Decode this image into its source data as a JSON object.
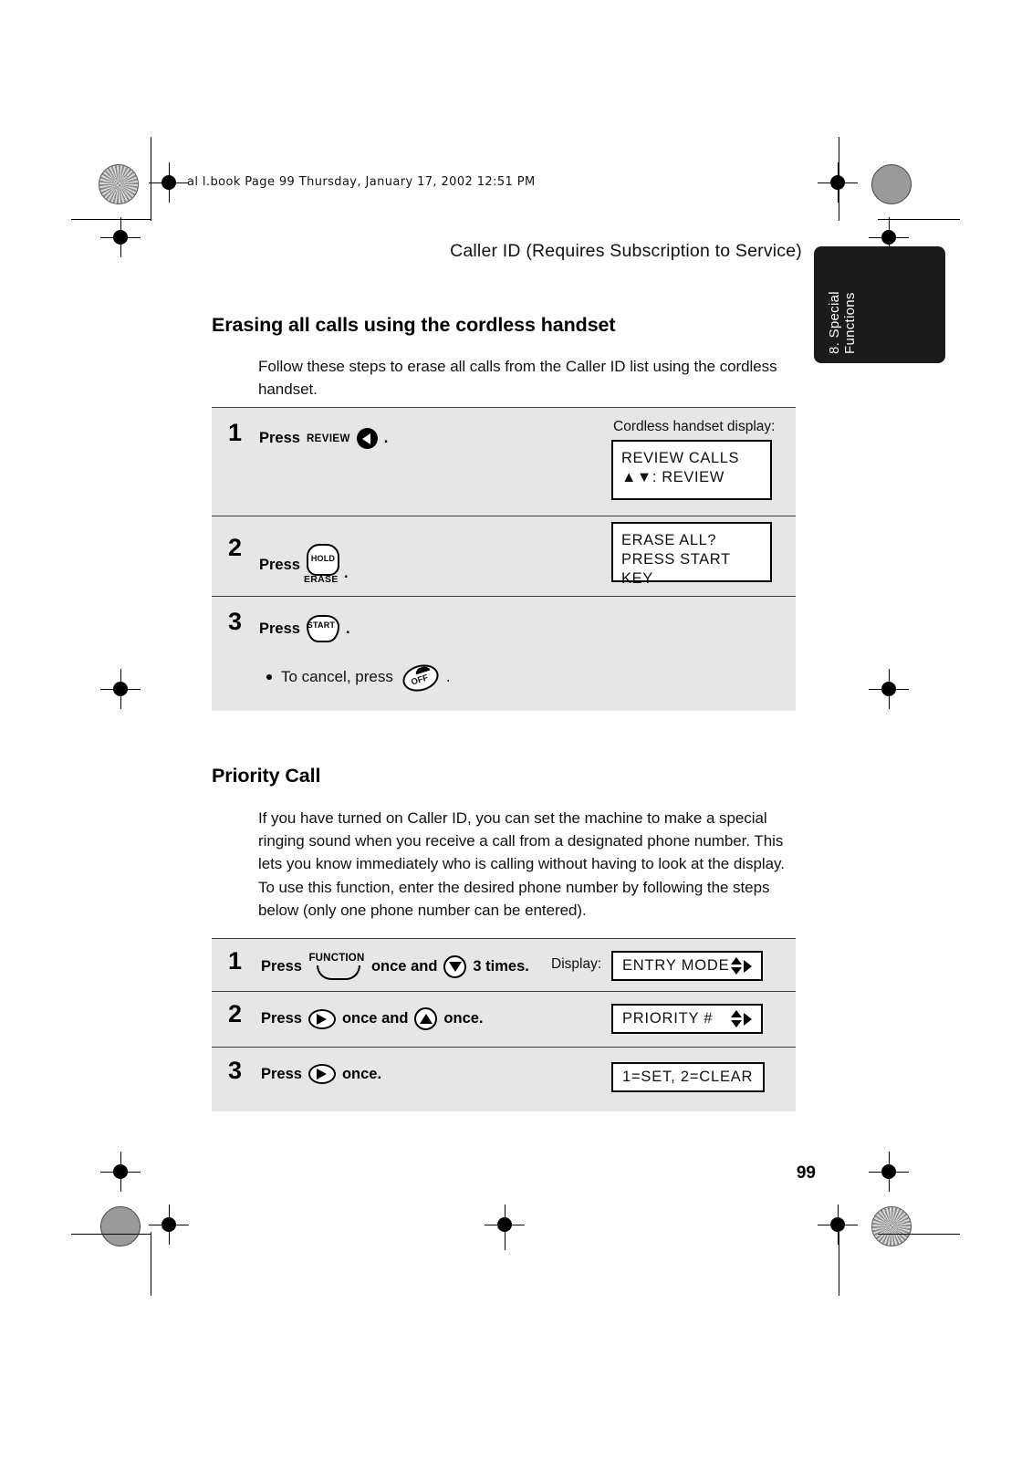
{
  "print_header": {
    "book_line": "al l.book  Page 99  Thursday,  January 17,  2002  12:51 PM"
  },
  "running_head": "Caller ID (Requires Subscription to Service)",
  "chapter_tab": {
    "label": "8. Special\nFunctions"
  },
  "page_number": "99",
  "sections": [
    {
      "title": "Erasing all calls using the cordless handset",
      "intro": "Follow these steps to erase all calls from the Caller ID list using the cordless handset.",
      "display_caption": "Cordless handset display:",
      "steps": [
        {
          "number": "1",
          "press_label": "Press",
          "key_label": "REVIEW",
          "key_icon": "left-triangle-circle-key",
          "period": ".",
          "display_lines": [
            "REVIEW CALLS",
            "▲▼: REVIEW"
          ]
        },
        {
          "number": "2",
          "press_label": "Press",
          "key_label_top": "HOLD",
          "key_label_bottom": "ERASE",
          "period": ".",
          "display_lines": [
            "ERASE ALL?",
            "PRESS START KEY"
          ]
        },
        {
          "number": "3",
          "press_label": "Press",
          "key_label": "START",
          "period": ".",
          "note_prefix": "To cancel, press",
          "note_key_label": "OFF",
          "note_period": "."
        }
      ]
    },
    {
      "title": "Priority Call",
      "para1": "If you have turned on Caller ID, you can set the machine to make a special ringing sound when you receive a call from a designated phone number. This lets you know immediately who is calling without having to look at the display.",
      "para2": "To use this function, enter the desired phone number by following the steps below (only one phone number can be entered).",
      "display_caption": "Display:",
      "steps": [
        {
          "number": "1",
          "press_label": "Press",
          "key_label": "FUNCTION",
          "mid_text": "once and",
          "key2_icon": "down-triangle-circle-key",
          "tail_text": "3 times.",
          "display_value": "ENTRY MODE"
        },
        {
          "number": "2",
          "press_label": "Press",
          "key_icon": "right-arrow-oval-key",
          "mid_text": "once and",
          "key2_icon": "up-triangle-circle-key",
          "tail_text": "once.",
          "display_value": "PRIORITY #"
        },
        {
          "number": "3",
          "press_label": "Press",
          "key_icon": "right-arrow-oval-key",
          "tail_text": "once.",
          "display_value": "1=SET, 2=CLEAR"
        }
      ]
    }
  ],
  "colors": {
    "step_block_bg": "#e6e6e6",
    "chapter_tab_bg": "#1b1b1b",
    "text": "#111111"
  }
}
